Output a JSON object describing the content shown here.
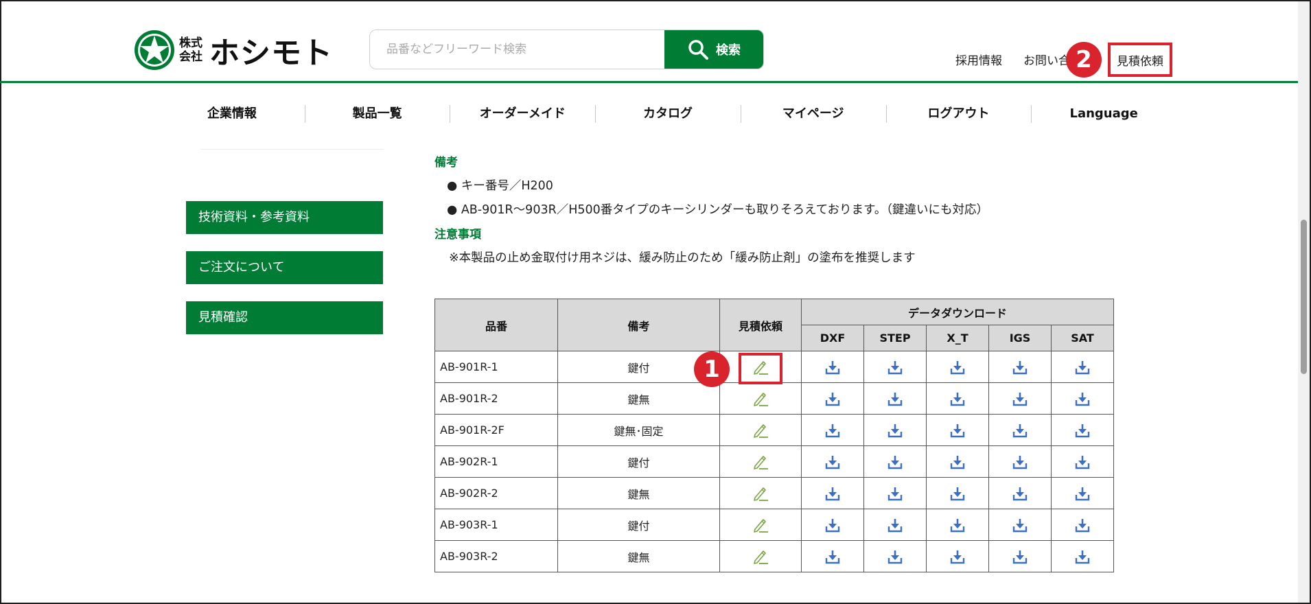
{
  "header": {
    "logo_kaisha_line1": "株式",
    "logo_kaisha_line2": "会社",
    "logo_name": "ホシモト",
    "search_placeholder": "品番などフリーワード検索",
    "search_button": "検索",
    "top_links": {
      "recruit": "採用情報",
      "contact": "お問い合",
      "quote_request": "見積依頼"
    }
  },
  "annotations": {
    "badge_1": "1",
    "badge_2": "2"
  },
  "nav": [
    "企業情報",
    "製品一覧",
    "オーダーメイド",
    "カタログ",
    "マイページ",
    "ログアウト",
    "Language"
  ],
  "sidebar": {
    "buttons": [
      "技術資料・参考資料",
      "ご注文について",
      "見積確認"
    ]
  },
  "content": {
    "remarks_title": "備考",
    "remarks": [
      "● キー番号／H200",
      "● AB-901R～903R／H500番タイプのキーシリンダーも取りそろえております。（鍵違いにも対応）"
    ],
    "caution_title": "注意事項",
    "caution": "※本製品の止め金取付け用ネジは、緩み防止のため「緩み防止剤」の塗布を推奨します"
  },
  "table": {
    "headers": {
      "part_no": "品番",
      "note": "備考",
      "quote": "見積依頼",
      "download": "データダウンロード",
      "formats": [
        "DXF",
        "STEP",
        "X_T",
        "IGS",
        "SAT"
      ]
    },
    "rows": [
      {
        "part_no": "AB-901R-1",
        "note": "鍵付"
      },
      {
        "part_no": "AB-901R-2",
        "note": "鍵無"
      },
      {
        "part_no": "AB-901R-2F",
        "note": "鍵無･固定"
      },
      {
        "part_no": "AB-902R-1",
        "note": "鍵付"
      },
      {
        "part_no": "AB-902R-2",
        "note": "鍵無"
      },
      {
        "part_no": "AB-903R-1",
        "note": "鍵付"
      },
      {
        "part_no": "AB-903R-2",
        "note": "鍵無"
      }
    ]
  },
  "colors": {
    "brand_green": "#007c35",
    "highlight_red": "#d9232d",
    "download_blue": "#3a6fc4",
    "quote_icon_green": "#7aa344"
  },
  "icons": {
    "search": "search-icon",
    "quote": "pencil-icon",
    "download": "download-icon",
    "logo": "star-icon"
  }
}
